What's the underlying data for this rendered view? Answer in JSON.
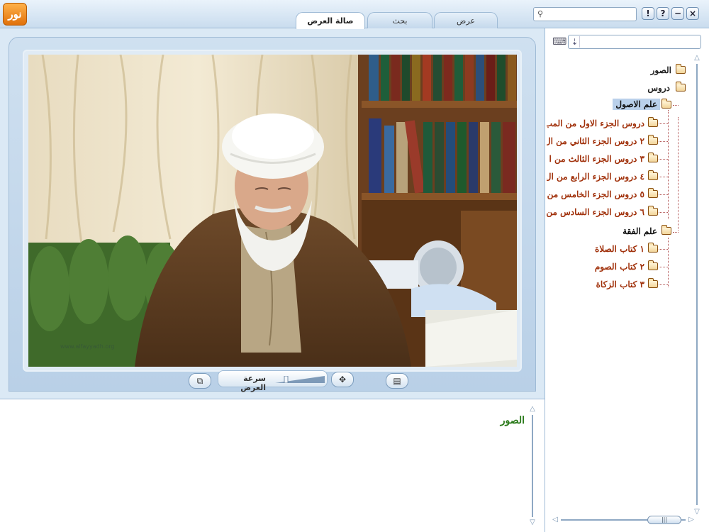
{
  "app": {
    "logo_text": "نور"
  },
  "tabs": [
    {
      "label": "صالة العرض",
      "active": true
    },
    {
      "label": "بحث",
      "active": false
    },
    {
      "label": "عرض",
      "active": false
    }
  ],
  "window_buttons": {
    "info": "!",
    "help": "?",
    "minimize": "−",
    "close": "×"
  },
  "top_search": {
    "value": "",
    "placeholder": ""
  },
  "tree_search": {
    "value": "",
    "placeholder": ""
  },
  "tree": {
    "root_photos": "الصور",
    "lessons": "دروس",
    "usul": "علم الاصول",
    "usul_items": [
      "دروس الجزء الاول من المب",
      "٢ دروس الجزء الثاني من ال",
      "٣ دروس الجزء الثالث من ا",
      "٤ دروس الجزء الرابع من ال",
      "٥ دروس الجزء الخامس من",
      "٦ دروس الجزء السادس من"
    ],
    "fiqh": "علم الفقة",
    "fiqh_items": [
      "١ كتاب الصلاة",
      "٢ كتاب الصوم",
      "٣ كتاب الزكاة"
    ]
  },
  "viewer": {
    "speed_label": "سرعة العرض",
    "speed_level": 0.2,
    "watermark": "www.alfayyadh.org"
  },
  "detail": {
    "title": "الصور"
  },
  "colors": {
    "tree_item": "#a0300a",
    "tree_header": "#222222",
    "detail_title": "#2a7a1a",
    "selection": "#b9d0ea"
  },
  "icons": [
    "search-icon",
    "keyboard-icon",
    "arrow-down-icon",
    "folder-icon",
    "folder-open-icon",
    "fullscreen-icon",
    "save-icon",
    "gallery-icon"
  ]
}
